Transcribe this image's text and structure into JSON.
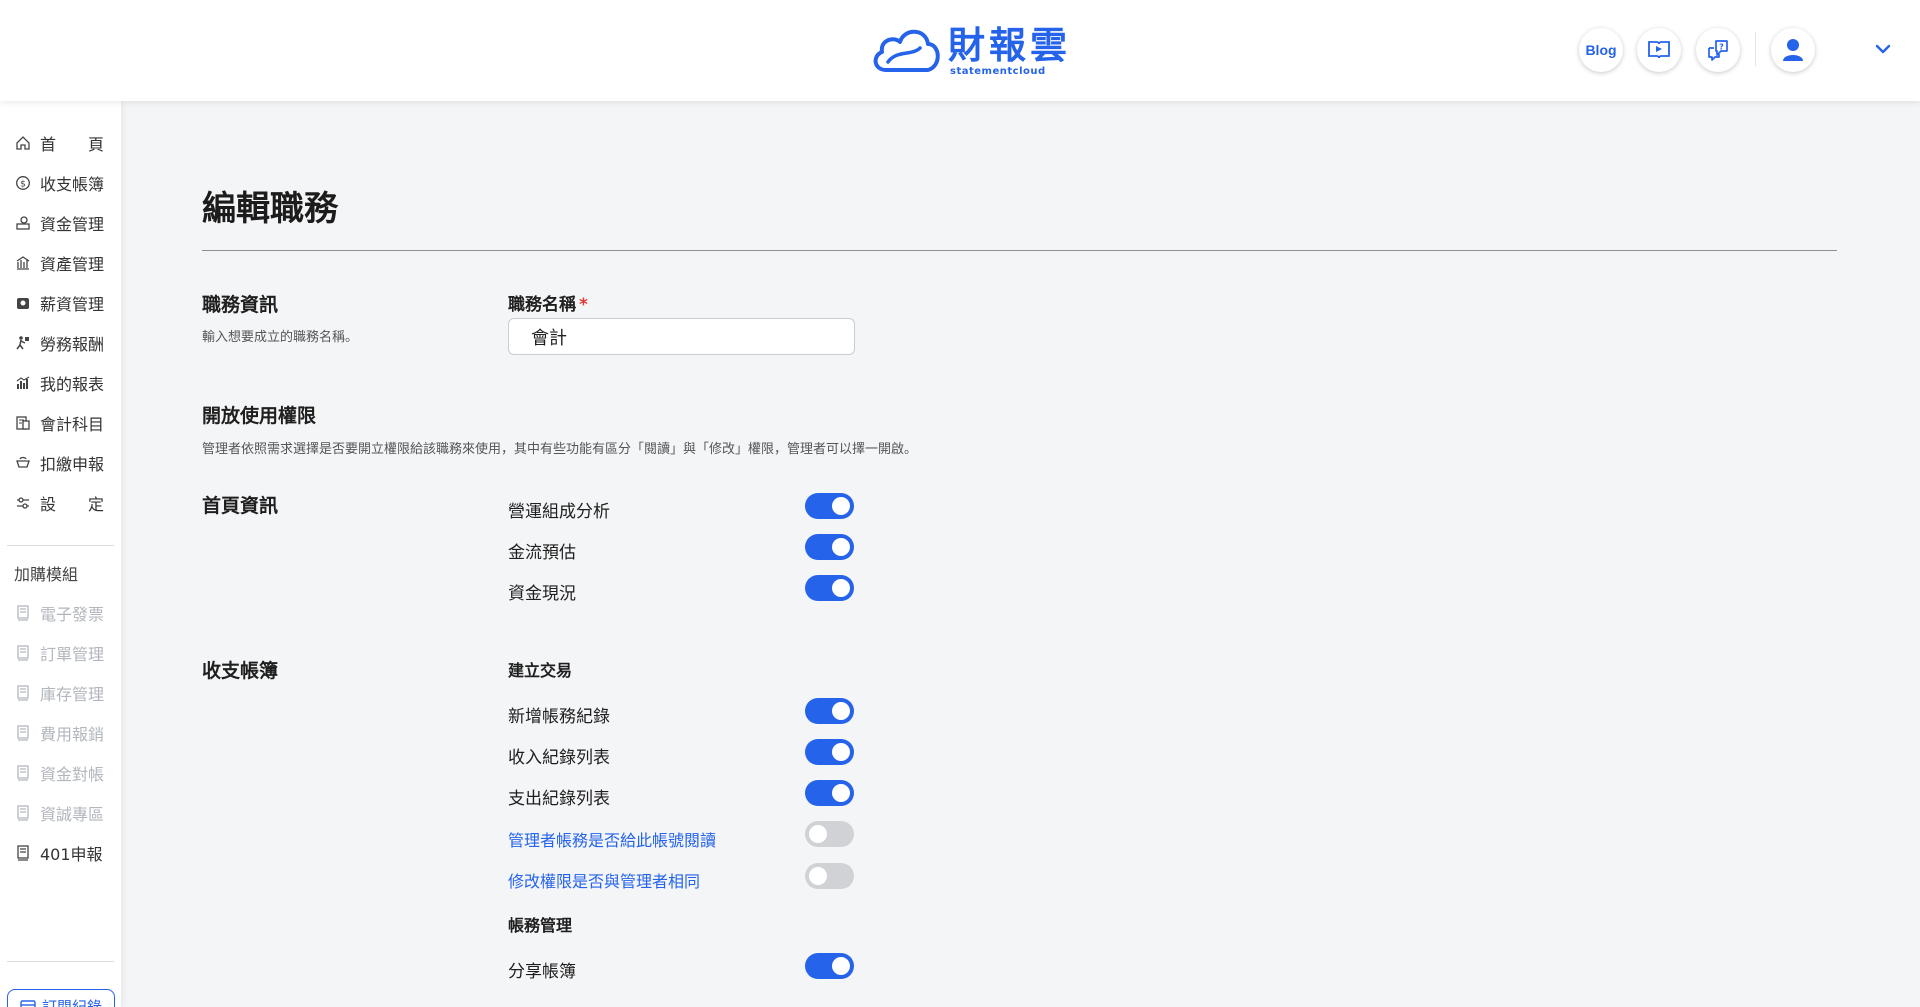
{
  "header": {
    "logo_cn": "財報雲",
    "logo_en": "statementcloud",
    "blog_label": "Blog",
    "icons": [
      "video-tutorial-icon",
      "help-chat-icon",
      "user-avatar-icon",
      "chevron-down-icon"
    ]
  },
  "sidebar": {
    "items": [
      {
        "label": "首　　頁",
        "icon": "home-icon"
      },
      {
        "label": "收支帳簿",
        "icon": "cash-icon"
      },
      {
        "label": "資金管理",
        "icon": "fund-icon"
      },
      {
        "label": "資產管理",
        "icon": "asset-icon"
      },
      {
        "label": "薪資管理",
        "icon": "payroll-icon"
      },
      {
        "label": "勞務報酬",
        "icon": "labor-icon"
      },
      {
        "label": "我的報表",
        "icon": "report-icon"
      },
      {
        "label": "會計科目",
        "icon": "ledger-icon"
      },
      {
        "label": "扣繳申報",
        "icon": "withholding-icon"
      },
      {
        "label": "設　　定",
        "icon": "settings-icon"
      }
    ],
    "addon_title": "加購模組",
    "addons": [
      {
        "label": "電子發票",
        "disabled": true
      },
      {
        "label": "訂單管理",
        "disabled": true
      },
      {
        "label": "庫存管理",
        "disabled": true
      },
      {
        "label": "費用報銷",
        "disabled": true
      },
      {
        "label": "資金對帳",
        "disabled": true
      },
      {
        "label": "資誠專區",
        "disabled": true
      },
      {
        "label": "401申報",
        "disabled": false
      }
    ],
    "subscription_label": "訂閱紀錄"
  },
  "main": {
    "page_title": "編輯職務",
    "job_info": {
      "title": "職務資訊",
      "desc": "輸入想要成立的職務名稱。",
      "field_label": "職務名稱",
      "required_mark": "*",
      "field_value": "會計"
    },
    "permissions": {
      "title": "開放使用權限",
      "desc": "管理者依照需求選擇是否要開立權限給該職務來使用，其中有些功能有區分「閱讀」與「修改」權限，管理者可以擇一開啟。"
    },
    "home_section": {
      "title": "首頁資訊",
      "items": [
        {
          "label": "營運組成分析",
          "on": true
        },
        {
          "label": "金流預估",
          "on": true
        },
        {
          "label": "資金現況",
          "on": true
        }
      ]
    },
    "books_section": {
      "title": "收支帳簿",
      "group1_title": "建立交易",
      "group1_items": [
        {
          "label": "新增帳務紀錄",
          "on": true
        },
        {
          "label": "收入紀錄列表",
          "on": true
        },
        {
          "label": "支出紀錄列表",
          "on": true
        },
        {
          "label": "管理者帳務是否給此帳號閱讀",
          "on": false
        },
        {
          "label": "修改權限是否與管理者相同",
          "on": false
        }
      ],
      "group2_title": "帳務管理",
      "group2_items": [
        {
          "label": "分享帳簿",
          "on": true
        }
      ]
    }
  },
  "colors": {
    "accent": "#2563eb",
    "toggle_off": "#d0d2d6",
    "required": "#e53935",
    "background": "#f4f5f7"
  }
}
